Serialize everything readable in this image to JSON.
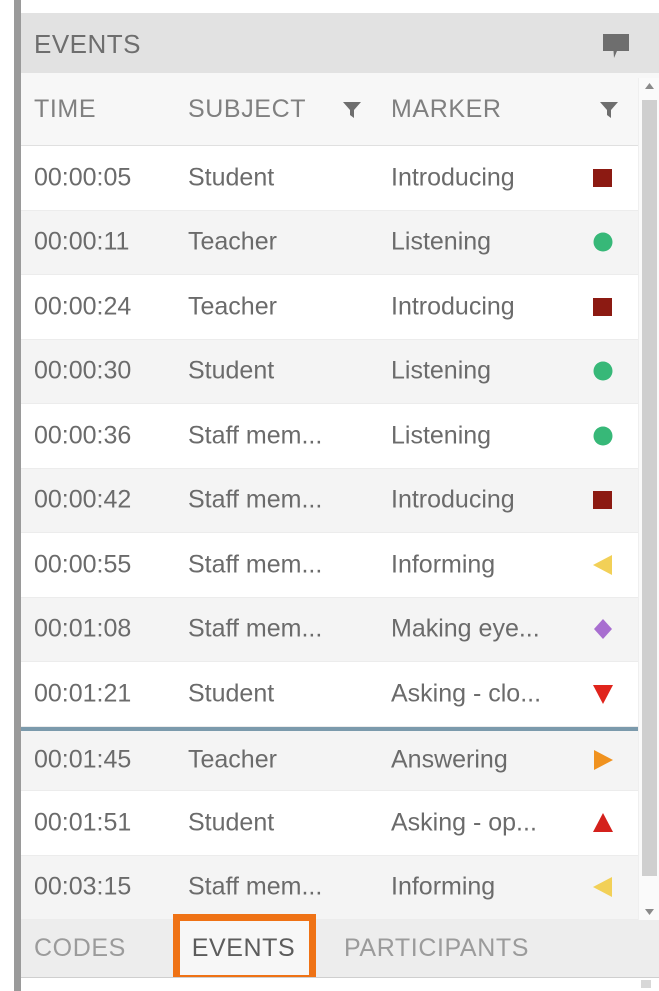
{
  "panel": {
    "title": "EVENTS",
    "comment_icon": "speech-bubble-icon"
  },
  "colors": {
    "header_bg": "#e2e2e2",
    "accent_orange": "#ef7215",
    "selection_line": "#7b9aac",
    "marker_dark_red": "#8c1a12",
    "marker_green": "#37b878",
    "marker_yellow": "#f2d057",
    "marker_purple": "#a86ed0",
    "marker_red": "#e0241c",
    "marker_orange": "#f0921f"
  },
  "table": {
    "columns": [
      {
        "key": "time",
        "label": "TIME",
        "filter": false
      },
      {
        "key": "subject",
        "label": "SUBJECT",
        "filter": true,
        "filter_icon": "funnel-icon"
      },
      {
        "key": "marker",
        "label": "MARKER",
        "filter": true,
        "filter_icon": "funnel-icon"
      }
    ],
    "rows": [
      {
        "time": "00:00:05",
        "subject": "Student",
        "marker": "Introducing",
        "shape": "square",
        "color": "#8c1a12",
        "separator_above": false
      },
      {
        "time": "00:00:11",
        "subject": "Teacher",
        "marker": "Listening",
        "shape": "circle",
        "color": "#37b878",
        "separator_above": false
      },
      {
        "time": "00:00:24",
        "subject": "Teacher",
        "marker": "Introducing",
        "shape": "square",
        "color": "#8c1a12",
        "separator_above": false
      },
      {
        "time": "00:00:30",
        "subject": "Student",
        "marker": "Listening",
        "shape": "circle",
        "color": "#37b878",
        "separator_above": false
      },
      {
        "time": "00:00:36",
        "subject": "Staff mem...",
        "marker": "Listening",
        "shape": "circle",
        "color": "#37b878",
        "separator_above": false
      },
      {
        "time": "00:00:42",
        "subject": "Staff mem...",
        "marker": "Introducing",
        "shape": "square",
        "color": "#8c1a12",
        "separator_above": false
      },
      {
        "time": "00:00:55",
        "subject": "Staff mem...",
        "marker": "Informing",
        "shape": "triangle-left",
        "color": "#f2d057",
        "separator_above": false
      },
      {
        "time": "00:01:08",
        "subject": "Staff mem...",
        "marker": "Making eye...",
        "shape": "diamond",
        "color": "#a86ed0",
        "separator_above": false
      },
      {
        "time": "00:01:21",
        "subject": "Student",
        "marker": "Asking - clo...",
        "shape": "triangle-down",
        "color": "#e0241c",
        "separator_above": false
      },
      {
        "time": "00:01:45",
        "subject": "Teacher",
        "marker": "Answering",
        "shape": "triangle-right",
        "color": "#f0921f",
        "separator_above": true
      },
      {
        "time": "00:01:51",
        "subject": "Student",
        "marker": "Asking - op...",
        "shape": "triangle-up",
        "color": "#d4211c",
        "separator_above": false
      },
      {
        "time": "00:03:15",
        "subject": "Staff mem...",
        "marker": "Informing",
        "shape": "triangle-left",
        "color": "#f2d057",
        "separator_above": false
      }
    ]
  },
  "scrollbar": {
    "up_icon": "chevron-up-icon",
    "down_icon": "chevron-down-icon"
  },
  "tabs": [
    {
      "label": "CODES",
      "active": false
    },
    {
      "label": "EVENTS",
      "active": true
    },
    {
      "label": "PARTICIPANTS",
      "active": false
    }
  ]
}
